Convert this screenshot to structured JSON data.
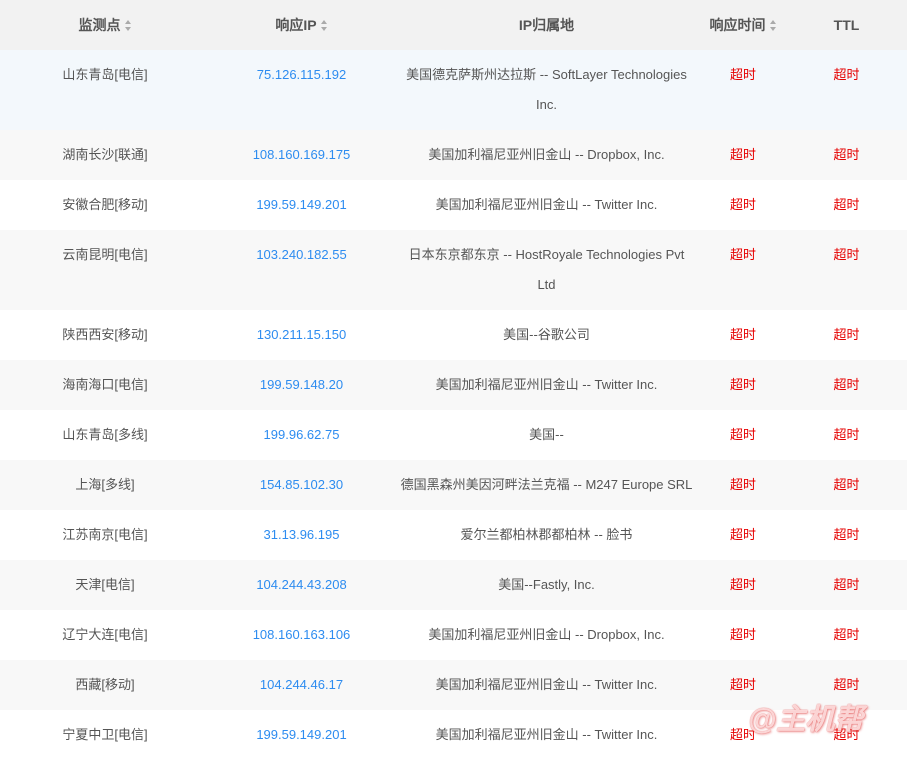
{
  "colors": {
    "link": "#2d8cf0",
    "timeout": "#e60000",
    "header_bg": "#f2f2f2",
    "stripe_bg": "#f8f8f8",
    "hover_bg": "#f3f8fc",
    "header_text": "#555555",
    "cell_text": "#555555"
  },
  "icons": {
    "sort": "sort-caret-icon"
  },
  "table": {
    "columns": [
      {
        "label": "监测点",
        "sortable": true
      },
      {
        "label": "响应IP",
        "sortable": true
      },
      {
        "label": "IP归属地",
        "sortable": false
      },
      {
        "label": "响应时间",
        "sortable": true
      },
      {
        "label": "TTL",
        "sortable": false
      }
    ],
    "rows": [
      {
        "location": "山东青岛[电信]",
        "ip": "75.126.115.192",
        "geo": "美国德克萨斯州达拉斯 -- SoftLayer Technologies Inc.",
        "response_time": "超时",
        "ttl": "超时"
      },
      {
        "location": "湖南长沙[联通]",
        "ip": "108.160.169.175",
        "geo": "美国加利福尼亚州旧金山 -- Dropbox, Inc.",
        "response_time": "超时",
        "ttl": "超时"
      },
      {
        "location": "安徽合肥[移动]",
        "ip": "199.59.149.201",
        "geo": "美国加利福尼亚州旧金山 -- Twitter Inc.",
        "response_time": "超时",
        "ttl": "超时"
      },
      {
        "location": "云南昆明[电信]",
        "ip": "103.240.182.55",
        "geo": "日本东京都东京 -- HostRoyale Technologies Pvt Ltd",
        "response_time": "超时",
        "ttl": "超时"
      },
      {
        "location": "陕西西安[移动]",
        "ip": "130.211.15.150",
        "geo": "美国--谷歌公司",
        "response_time": "超时",
        "ttl": "超时"
      },
      {
        "location": "海南海口[电信]",
        "ip": "199.59.148.20",
        "geo": "美国加利福尼亚州旧金山 -- Twitter Inc.",
        "response_time": "超时",
        "ttl": "超时"
      },
      {
        "location": "山东青岛[多线]",
        "ip": "199.96.62.75",
        "geo": "美国--",
        "response_time": "超时",
        "ttl": "超时"
      },
      {
        "location": "上海[多线]",
        "ip": "154.85.102.30",
        "geo": "德国黑森州美因河畔法兰克福 -- M247 Europe SRL",
        "response_time": "超时",
        "ttl": "超时"
      },
      {
        "location": "江苏南京[电信]",
        "ip": "31.13.96.195",
        "geo": "爱尔兰都柏林郡都柏林 -- 脸书",
        "response_time": "超时",
        "ttl": "超时"
      },
      {
        "location": "天津[电信]",
        "ip": "104.244.43.208",
        "geo": "美国--Fastly, Inc.",
        "response_time": "超时",
        "ttl": "超时"
      },
      {
        "location": "辽宁大连[电信]",
        "ip": "108.160.163.106",
        "geo": "美国加利福尼亚州旧金山 -- Dropbox, Inc.",
        "response_time": "超时",
        "ttl": "超时"
      },
      {
        "location": "西藏[移动]",
        "ip": "104.244.46.17",
        "geo": "美国加利福尼亚州旧金山 -- Twitter Inc.",
        "response_time": "超时",
        "ttl": "超时"
      },
      {
        "location": "宁夏中卫[电信]",
        "ip": "199.59.149.201",
        "geo": "美国加利福尼亚州旧金山 -- Twitter Inc.",
        "response_time": "超时",
        "ttl": "超时"
      }
    ]
  },
  "watermark": "@主机帮"
}
